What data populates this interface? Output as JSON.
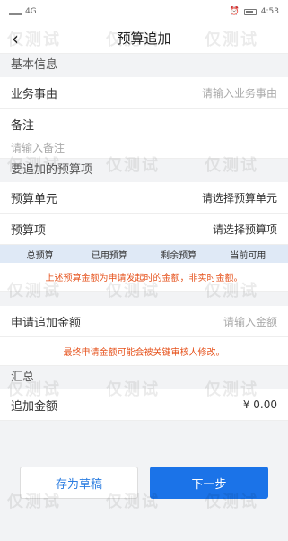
{
  "status": {
    "signal": "4G",
    "time": "4:53"
  },
  "nav": {
    "title": "预算追加"
  },
  "basic": {
    "section": "基本信息",
    "reason_label": "业务事由",
    "reason_placeholder": "请输入业务事由",
    "remark_label": "备注",
    "remark_placeholder": "请输入备注"
  },
  "budget": {
    "section": "要追加的预算项",
    "unit_label": "预算单元",
    "unit_placeholder": "请选择预算单元",
    "item_label": "预算项",
    "item_placeholder": "请选择预算项",
    "columns": [
      "总预算",
      "已用预算",
      "剩余预算",
      "当前可用"
    ],
    "note": "上述预算金额为申请发起时的金额，非实时金额。"
  },
  "apply": {
    "label": "申请追加金额",
    "placeholder": "请输入金额",
    "note": "最终申请金额可能会被关键审核人修改。"
  },
  "summary": {
    "section": "汇总",
    "total_label": "追加金额",
    "total_value": "¥ 0.00"
  },
  "actions": {
    "draft": "存为草稿",
    "next": "下一步"
  },
  "watermark": "仅测试"
}
